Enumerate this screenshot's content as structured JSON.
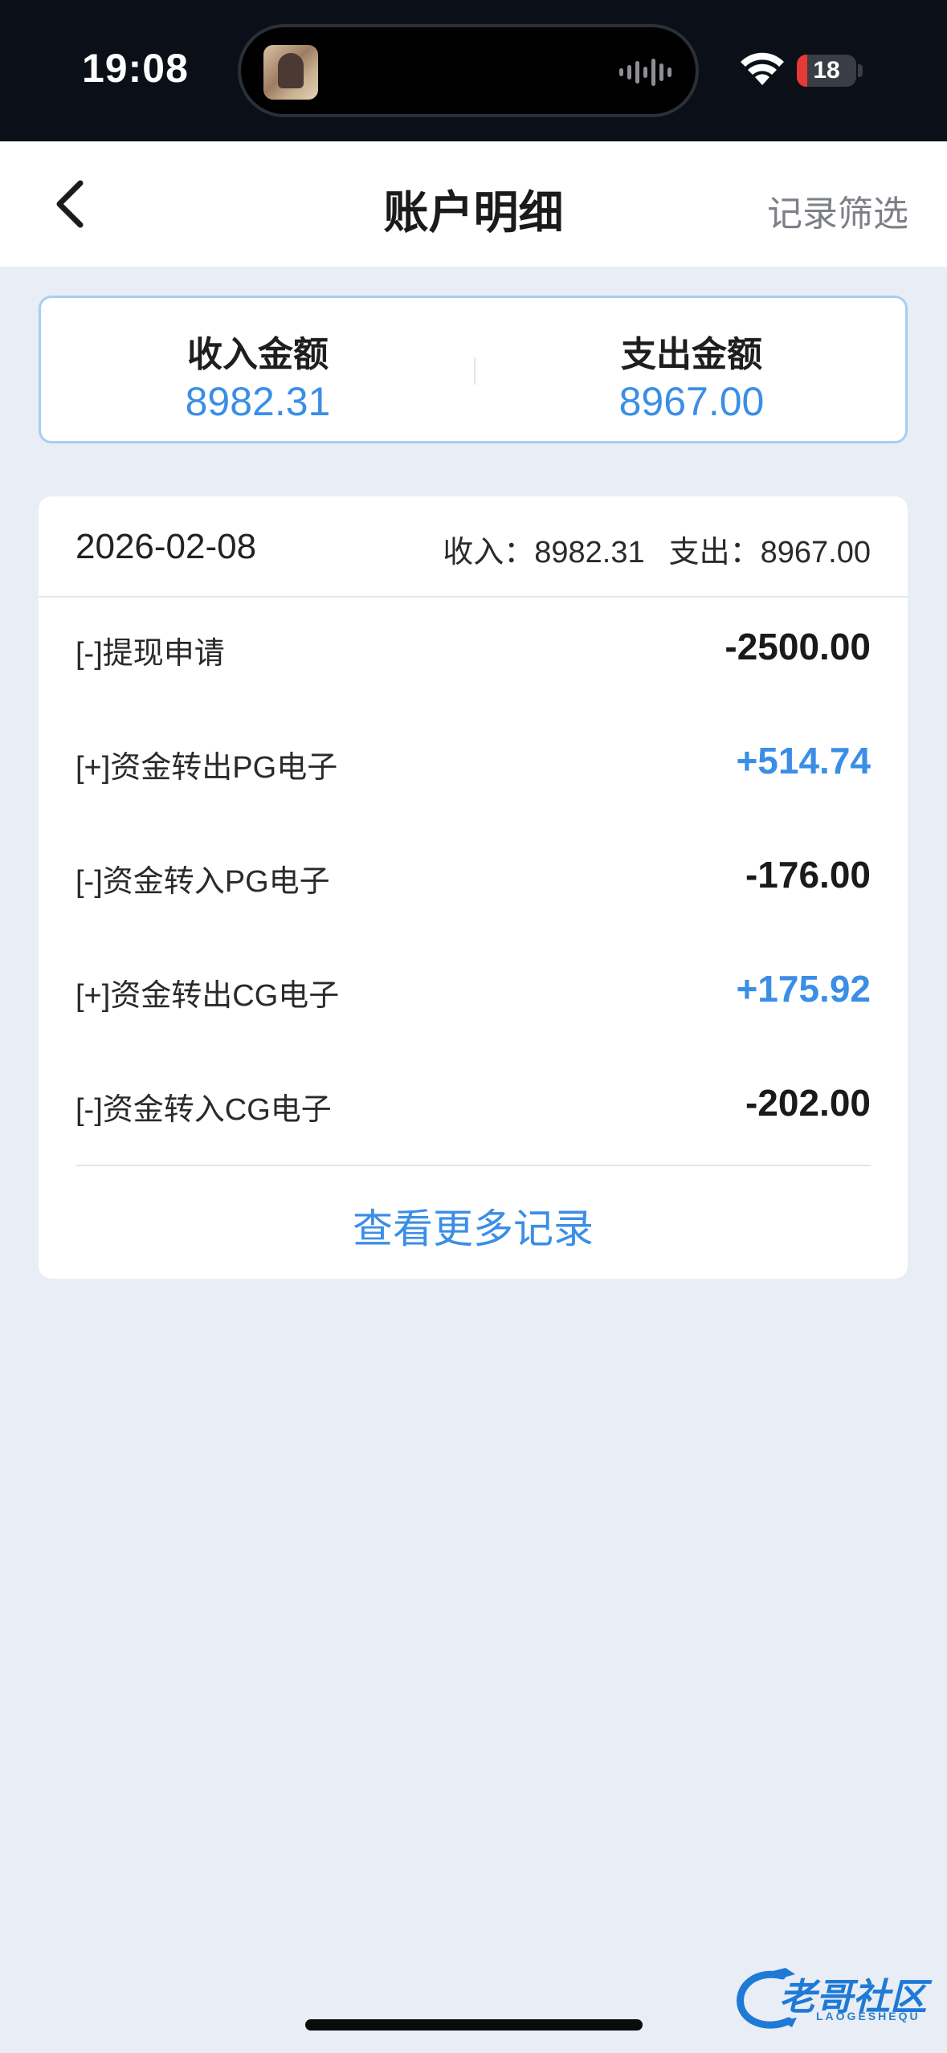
{
  "status_bar": {
    "time": "19:08",
    "battery_level": "18",
    "battery_fraction": 0.18,
    "battery_color": "#e53935"
  },
  "nav": {
    "title": "账户明细",
    "filter_label": "记录筛选"
  },
  "summary": {
    "income_label": "收入金额",
    "income_value": "8982.31",
    "expense_label": "支出金额",
    "expense_value": "8967.00"
  },
  "records": {
    "date": "2026-02-08",
    "income_text": "收入：8982.31",
    "expense_text": "支出：8967.00",
    "items": [
      {
        "name": "[-]提现申请",
        "amount": "-2500.00",
        "type": "neg"
      },
      {
        "name": "[+]资金转出PG电子",
        "amount": "+514.74",
        "type": "pos"
      },
      {
        "name": "[-]资金转入PG电子",
        "amount": "-176.00",
        "type": "neg"
      },
      {
        "name": "[+]资金转出CG电子",
        "amount": "+175.92",
        "type": "pos"
      },
      {
        "name": "[-]资金转入CG电子",
        "amount": "-202.00",
        "type": "neg"
      }
    ],
    "more_label": "查看更多记录"
  },
  "watermark": {
    "title": "老哥社区",
    "subtitle": "LAOGESHEQU"
  },
  "colors": {
    "accent": "#3b8ee6",
    "background": "#e8edf6"
  }
}
